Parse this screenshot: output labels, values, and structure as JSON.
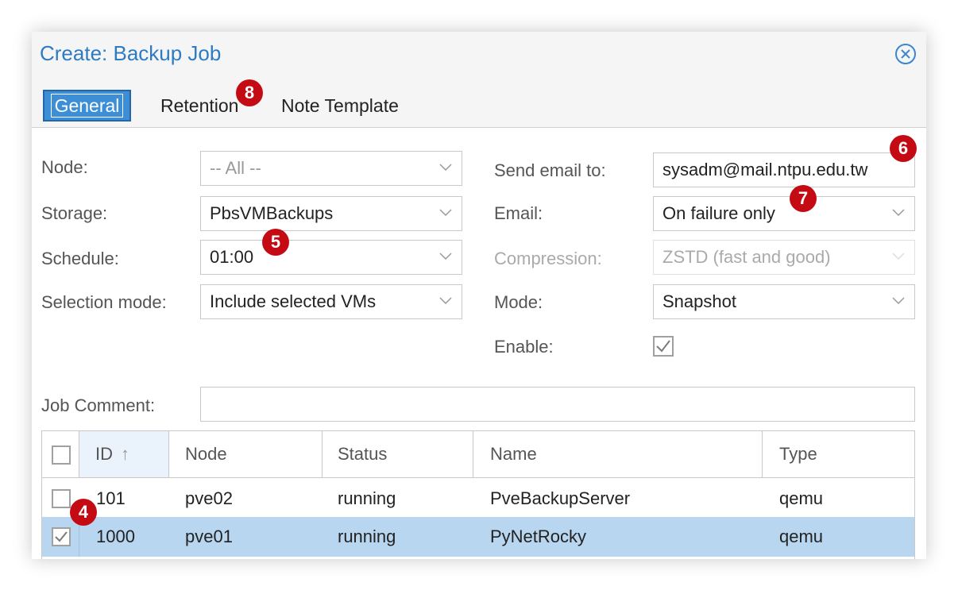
{
  "dialog": {
    "title": "Create: Backup Job"
  },
  "tabs": [
    {
      "label": "General",
      "active": true
    },
    {
      "label": "Retention",
      "active": false
    },
    {
      "label": "Note Template",
      "active": false
    }
  ],
  "badges": {
    "b4": "4",
    "b5": "5",
    "b6": "6",
    "b7": "7",
    "b8": "8"
  },
  "form": {
    "node": {
      "label": "Node:",
      "value": "-- All --"
    },
    "storage": {
      "label": "Storage:",
      "value": "PbsVMBackups"
    },
    "schedule": {
      "label": "Schedule:",
      "value": "01:00"
    },
    "selection_mode": {
      "label": "Selection mode:",
      "value": "Include selected VMs"
    },
    "send_email": {
      "label": "Send email to:",
      "value": "sysadm@mail.ntpu.edu.tw"
    },
    "email": {
      "label": "Email:",
      "value": "On failure only"
    },
    "compression": {
      "label": "Compression:",
      "value": "ZSTD (fast and good)"
    },
    "mode": {
      "label": "Mode:",
      "value": "Snapshot"
    },
    "enable": {
      "label": "Enable:",
      "checked": true
    },
    "job_comment": {
      "label": "Job Comment:",
      "value": ""
    }
  },
  "table": {
    "columns": [
      "ID",
      "Node",
      "Status",
      "Name",
      "Type"
    ],
    "sort_indicator": "↑",
    "rows": [
      {
        "id": "101",
        "node": "pve02",
        "status": "running",
        "name": "PveBackupServer",
        "type": "qemu",
        "checked": false
      },
      {
        "id": "1000",
        "node": "pve01",
        "status": "running",
        "name": "PyNetRocky",
        "type": "qemu",
        "checked": true
      }
    ]
  },
  "colors": {
    "accent": "#2d7bc4",
    "badge": "#c40b13",
    "selected_row": "#b8d6ef",
    "active_tab": "#3c8fd7"
  },
  "icons": {
    "close": "close-circle-icon",
    "dropdown": "chevron-down-icon",
    "checkbox": "checkbox-icon",
    "sort": "sort-ascending-icon"
  }
}
